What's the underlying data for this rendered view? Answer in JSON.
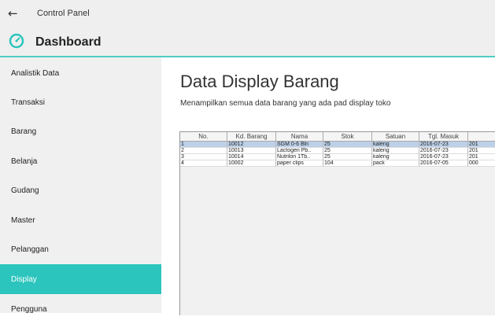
{
  "window": {
    "title": "Control Panel",
    "back_icon": "back-arrow-icon"
  },
  "header": {
    "title": "Dashboard",
    "icon": "dashboard-gauge-icon",
    "accent": "#2cc5bd"
  },
  "sidebar": {
    "items": [
      {
        "label": "Analistik Data"
      },
      {
        "label": "Transaksi"
      },
      {
        "label": "Barang"
      },
      {
        "label": "Belanja"
      },
      {
        "label": "Gudang"
      },
      {
        "label": "Master"
      },
      {
        "label": "Pelanggan"
      },
      {
        "label": "Display",
        "active": true
      },
      {
        "label": "Pengguna"
      }
    ]
  },
  "main": {
    "title": "Data Display Barang",
    "subtitle": "Menampilkan semua data barang yang ada pad display toko",
    "table": {
      "columns": [
        "No.",
        "Kd. Barang",
        "Nama",
        "Stok",
        "Satuan",
        "Tgl. Masuk",
        ""
      ],
      "rows": [
        [
          "1",
          "10012",
          "SGM 0-6 Bln",
          "25",
          "kaleng",
          "2016-07-23",
          "201"
        ],
        [
          "2",
          "10013",
          "Lactogen Pb..",
          "25",
          "kaleng",
          "2016-07-23",
          "201"
        ],
        [
          "3",
          "10014",
          "Nutrilon 1Tb..",
          "25",
          "kaleng",
          "2016-07-23",
          "201"
        ],
        [
          "4",
          "10002",
          "paper clips",
          "104",
          "pack",
          "2016-07-05",
          "000"
        ]
      ]
    }
  }
}
